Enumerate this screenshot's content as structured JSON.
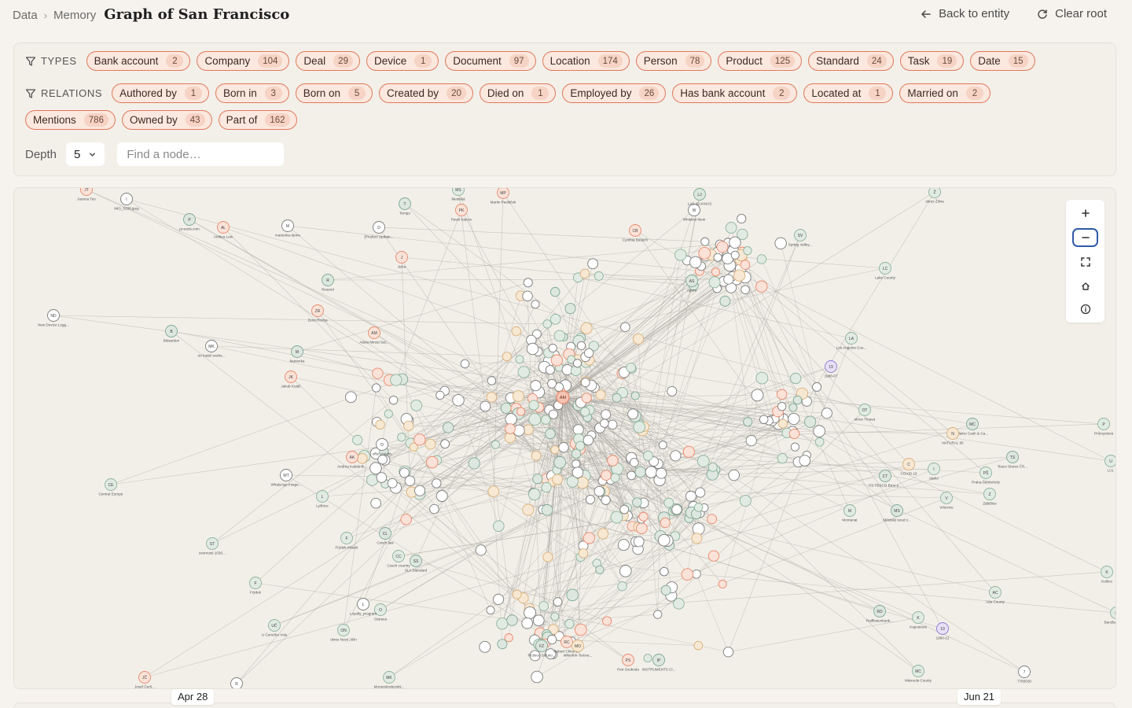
{
  "breadcrumb": {
    "items": [
      "Data",
      "Memory"
    ],
    "title": "Graph of San Francisco"
  },
  "actions": {
    "back": "Back to entity",
    "clear": "Clear root"
  },
  "filters": {
    "types_label": "TYPES",
    "types": [
      {
        "label": "Bank account",
        "count": "2"
      },
      {
        "label": "Company",
        "count": "104"
      },
      {
        "label": "Deal",
        "count": "29"
      },
      {
        "label": "Device",
        "count": "1"
      },
      {
        "label": "Document",
        "count": "97"
      },
      {
        "label": "Location",
        "count": "174"
      },
      {
        "label": "Person",
        "count": "78"
      },
      {
        "label": "Product",
        "count": "125"
      },
      {
        "label": "Standard",
        "count": "24"
      },
      {
        "label": "Task",
        "count": "19"
      },
      {
        "label": "Date",
        "count": "15"
      }
    ],
    "relations_label": "RELATIONS",
    "relations": [
      {
        "label": "Authored by",
        "count": "1"
      },
      {
        "label": "Born in",
        "count": "3"
      },
      {
        "label": "Born on",
        "count": "5"
      },
      {
        "label": "Created by",
        "count": "20"
      },
      {
        "label": "Died on",
        "count": "1"
      },
      {
        "label": "Employed by",
        "count": "26"
      },
      {
        "label": "Has bank account",
        "count": "2"
      },
      {
        "label": "Located at",
        "count": "1"
      },
      {
        "label": "Married on",
        "count": "2"
      },
      {
        "label": "Mentions",
        "count": "786"
      },
      {
        "label": "Owned by",
        "count": "43"
      },
      {
        "label": "Part of",
        "count": "162"
      }
    ]
  },
  "depth": {
    "label": "Depth",
    "value": "5"
  },
  "search": {
    "placeholder": "Find a node…"
  },
  "graph": {
    "hub": "AM",
    "named_nodes": [
      {
        "abbr": "JT",
        "label": "Joanna Teo",
        "type": "person"
      },
      {
        "abbr": "I",
        "label": "IMG_5338.jpeg",
        "type": "doc"
      },
      {
        "abbr": "P",
        "label": "pi-scels.com",
        "type": "company"
      },
      {
        "abbr": "AL",
        "label": "Anthea Low",
        "type": "person"
      },
      {
        "abbr": "M",
        "label": "marienka-demo",
        "type": "doc"
      },
      {
        "abbr": "ND",
        "label": "New Device Logg...",
        "type": "doc"
      },
      {
        "abbr": "B",
        "label": "Bitwarden",
        "type": "company"
      },
      {
        "abbr": "MK",
        "label": "mr kutáč works...",
        "type": "doc"
      },
      {
        "abbr": "M",
        "label": "Marienka",
        "type": "company"
      },
      {
        "abbr": "JK",
        "label": "Jakub Kutáč",
        "type": "person"
      },
      {
        "abbr": "ZR",
        "label": "Zeno Rocha",
        "type": "person"
      },
      {
        "abbr": "R",
        "label": "Resend",
        "type": "company"
      },
      {
        "abbr": "AM",
        "label": "Adela Mirzai Sat...",
        "type": "person"
      },
      {
        "abbr": "CE",
        "label": "Central Europe",
        "type": "location"
      },
      {
        "abbr": "L",
        "label": "Lyžbice",
        "type": "location"
      },
      {
        "abbr": "ST",
        "label": "svornosti 1030...",
        "type": "location"
      },
      {
        "abbr": "F",
        "label": "Frýdek-Místek",
        "type": "location"
      },
      {
        "abbr": "F",
        "label": "Frýdek",
        "type": "location"
      },
      {
        "abbr": "UČ",
        "label": "U Černého Vola",
        "type": "location"
      },
      {
        "abbr": "JČ",
        "label": "Josef Čerš...",
        "type": "person"
      },
      {
        "abbr": "R",
        "label": "R",
        "type": "doc"
      },
      {
        "abbr": "ON",
        "label": "okres Nový Jičín",
        "type": "location"
      },
      {
        "abbr": "O",
        "label": "Ostrava",
        "type": "location"
      },
      {
        "abbr": "L",
        "label": "Loyalty_program",
        "type": "doc"
      },
      {
        "abbr": "MK",
        "label": "Moravskoslezský...",
        "type": "location"
      },
      {
        "abbr": "SS",
        "label": "SLA Standard",
        "type": "standard"
      },
      {
        "abbr": "CC",
        "label": "Czech country",
        "type": "location"
      },
      {
        "abbr": "CL",
        "label": "Czech law",
        "type": "standard"
      },
      {
        "abbr": "LC",
        "label": "Lake County",
        "type": "location"
      },
      {
        "abbr": "LA",
        "label": "Los Angeles Cou...",
        "type": "location"
      },
      {
        "abbr": "19",
        "label": "1988-07",
        "type": "date"
      },
      {
        "abbr": "OT",
        "label": "okres Trnava",
        "type": "location"
      },
      {
        "abbr": "MC",
        "label": "Makro Cash & Ca...",
        "type": "company"
      },
      {
        "abbr": "N",
        "label": "NATURAL 95",
        "type": "product"
      },
      {
        "abbr": "P",
        "label": "Průmyslová",
        "type": "location"
      },
      {
        "abbr": "TS",
        "label": "Tesco Stores ČR...",
        "type": "company"
      },
      {
        "abbr": "U",
        "label": "U.S.",
        "type": "location"
      },
      {
        "abbr": "PŠ",
        "label": "Praha-Štěrboholy",
        "type": "location"
      },
      {
        "abbr": "Z",
        "label": "Zábělice",
        "type": "location"
      },
      {
        "abbr": "CT",
        "label": "CS TESCO Brno p...",
        "type": "company"
      },
      {
        "abbr": "C",
        "label": "COVID 19",
        "type": "product"
      },
      {
        "abbr": "I",
        "label": "Idaho",
        "type": "location"
      },
      {
        "abbr": "V",
        "label": "Vršovice",
        "type": "location"
      },
      {
        "abbr": "MS",
        "label": "Městský soud v...",
        "type": "company"
      },
      {
        "abbr": "M",
        "label": "Montanat",
        "type": "location"
      },
      {
        "abbr": "K",
        "label": "Košice",
        "type": "location"
      },
      {
        "abbr": "AC",
        "label": "Ada County",
        "type": "location"
      },
      {
        "abbr": "B",
        "label": "Barullas auto...",
        "type": "location"
      },
      {
        "abbr": "7",
        "label": "7780030",
        "type": "doc"
      },
      {
        "abbr": "MC",
        "label": "Missoula County",
        "type": "location"
      },
      {
        "abbr": "19",
        "label": "1980-12",
        "type": "date"
      },
      {
        "abbr": "RD",
        "label": "Raiffeisenbank...",
        "type": "company"
      },
      {
        "abbr": "K",
        "label": "Kapustová",
        "type": "location"
      },
      {
        "abbr": "Ž",
        "label": "okres Žilina",
        "type": "location"
      },
      {
        "abbr": "SV",
        "label": "Spring Valley...",
        "type": "location"
      },
      {
        "abbr": "AS",
        "label": "Agora",
        "type": "company"
      },
      {
        "abbr": "W",
        "label": "Whitelist theni",
        "type": "doc"
      },
      {
        "abbr": "LJ",
        "label": "LAS IGUANAS",
        "type": "company"
      },
      {
        "abbr": "CB",
        "label": "Cynthia Beusch",
        "type": "person"
      },
      {
        "abbr": "MS",
        "label": "Mestská",
        "type": "location"
      },
      {
        "abbr": "MP",
        "label": "Martin Pavláček",
        "type": "person"
      },
      {
        "abbr": "PK",
        "label": "Pavel Kalcev",
        "type": "person"
      },
      {
        "abbr": "D",
        "label": "[Product Update...",
        "type": "doc"
      },
      {
        "abbr": "T",
        "label": "Tempo",
        "type": "company"
      },
      {
        "abbr": "J",
        "label": "Julca",
        "type": "person"
      },
      {
        "abbr": "RC",
        "label": "Robert Chlumec",
        "type": "person"
      },
      {
        "abbr": "MO",
        "label": "Mikrofon-Tetova...",
        "type": "product"
      },
      {
        "abbr": "FZ",
        "label": "Fictisoo Solutio...",
        "type": "company"
      },
      {
        "abbr": "PS",
        "label": "Petr Svoboda",
        "type": "person"
      },
      {
        "abbr": "AK",
        "label": "Andrea Kabátník...",
        "type": "person"
      },
      {
        "abbr": "WT",
        "label": "WhatsApp Image...",
        "type": "doc"
      },
      {
        "abbr": "O",
        "label": "offer_italafix",
        "type": "doc"
      },
      {
        "abbr": "IP",
        "label": "INSTRUMENTS Cl...",
        "type": "company"
      }
    ]
  },
  "timeline": {
    "start": "Apr 28",
    "end": "Jun 21"
  },
  "colors": {
    "chip_border": "#e0795a",
    "chip_fill": "#fbe8df",
    "person": "#e98a6c",
    "company": "#7fa893",
    "location": "#8fb39b",
    "doc": "#7c7c7c",
    "date": "#8f7ad0",
    "product": "#d9b07a",
    "edge": "#a8a49e",
    "active_zoom": "#2f5aa7"
  },
  "icons": {
    "back": "arrow-left-icon",
    "clear": "refresh-icon",
    "filter": "filter-icon",
    "zoom_in": "plus-icon",
    "zoom_out": "minus-icon",
    "fit": "fullscreen-icon",
    "home": "home-icon",
    "info": "info-icon"
  }
}
